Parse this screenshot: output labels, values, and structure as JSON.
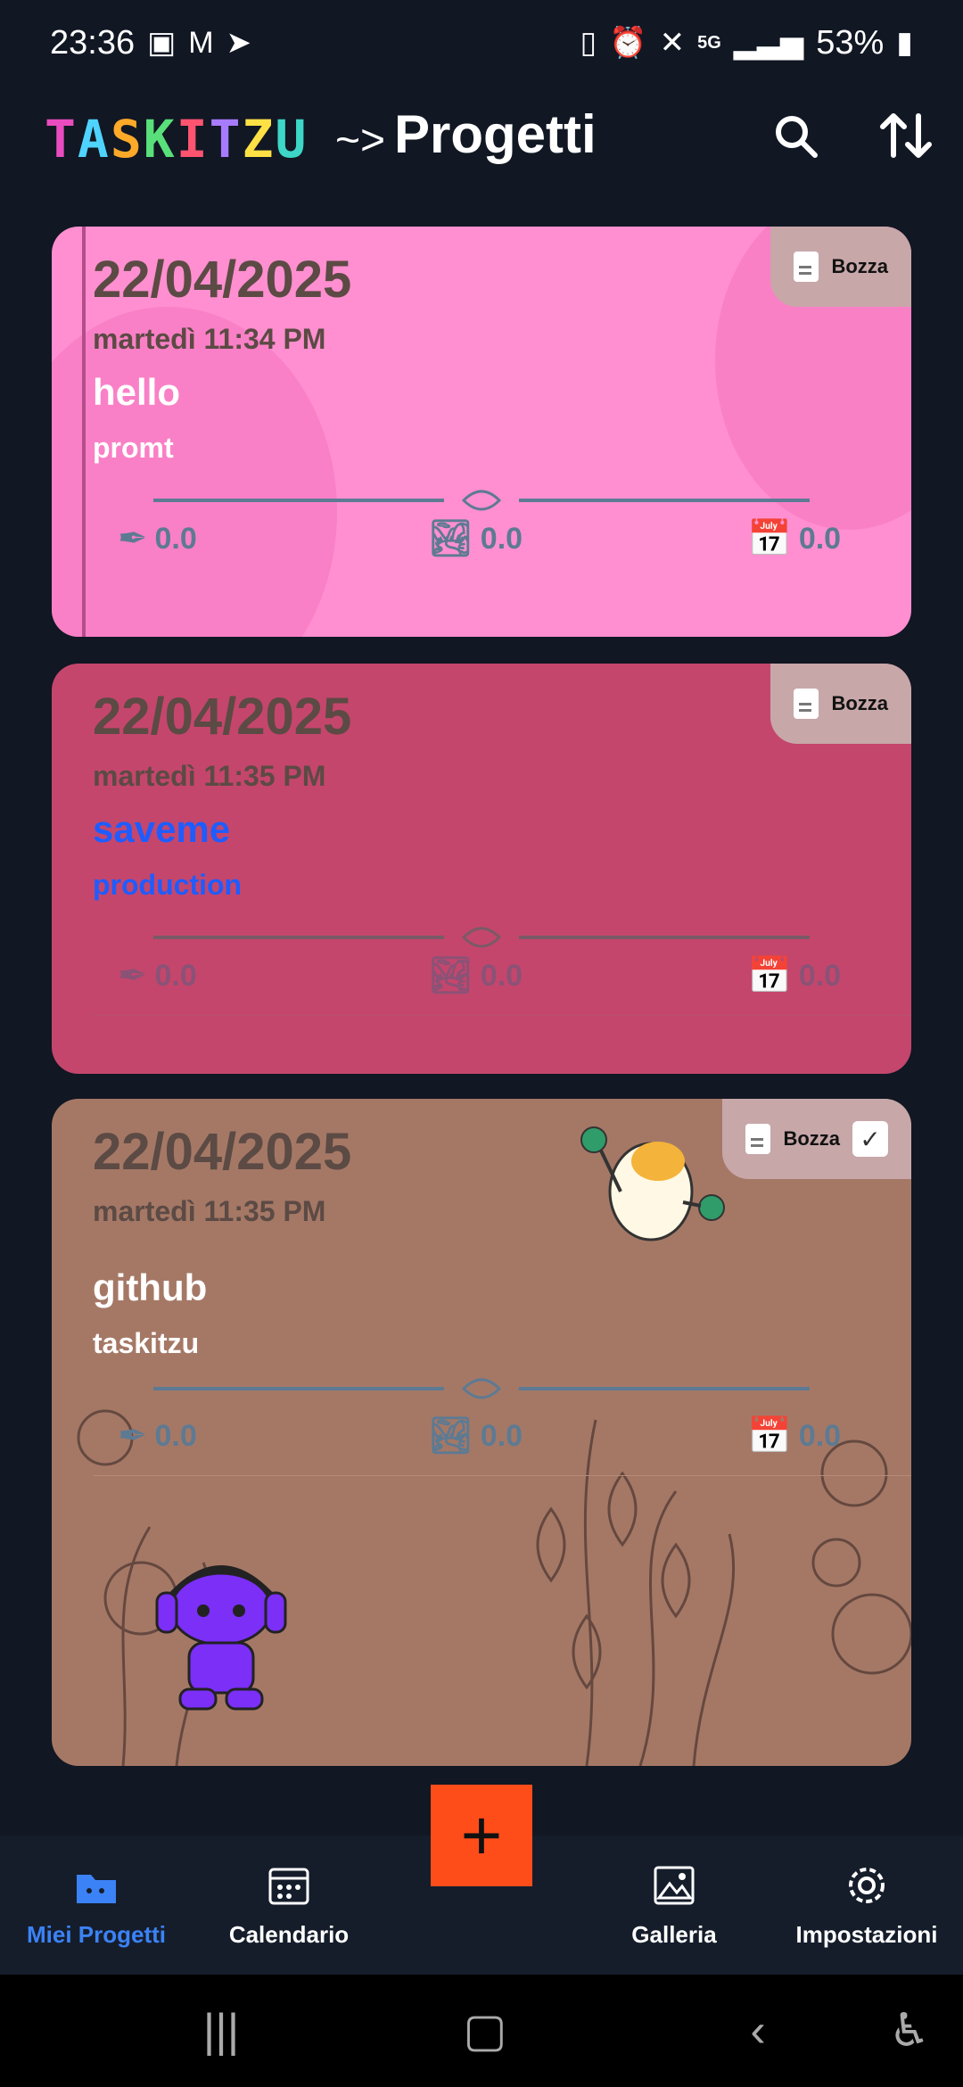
{
  "status_bar": {
    "time": "23:36",
    "battery": "53%",
    "network": "5G"
  },
  "app": {
    "logo": "TASKITZU",
    "arrow": "~>",
    "title": "Progetti"
  },
  "header_icons": {
    "search": "search-icon",
    "sort": "sort-icon"
  },
  "cards": [
    {
      "date": "22/04/2025",
      "weekday_time": "martedì 11:34 PM",
      "name": "hello",
      "description": "promt",
      "badge": "Bozza",
      "stats": {
        "writing": "0.0",
        "images": "0.0",
        "calendar": "0.0"
      },
      "colors": {
        "bg": "#ff8fd0",
        "name": "#ffffff"
      }
    },
    {
      "date": "22/04/2025",
      "weekday_time": "martedì 11:35 PM",
      "name": "saveme",
      "description": "production",
      "badge": "Bozza",
      "stats": {
        "writing": "0.0",
        "images": "0.0",
        "calendar": "0.0"
      },
      "colors": {
        "bg": "#c4466c",
        "name": "#1f5cff"
      }
    },
    {
      "date": "22/04/2025",
      "weekday_time": "martedì 11:35 PM",
      "name": "github",
      "description": "taskitzu",
      "badge": "Bozza",
      "stats": {
        "writing": "0.0",
        "images": "0.0",
        "calendar": "0.0"
      },
      "colors": {
        "bg": "#a57866",
        "name": "#ffffff"
      }
    }
  ],
  "fab": {
    "label": "+"
  },
  "bottom_nav": [
    {
      "label": "Miei Progetti",
      "icon": "folder-icon",
      "active": true
    },
    {
      "label": "Calendario",
      "icon": "calendar-icon",
      "active": false
    },
    {
      "label": "Galleria",
      "icon": "gallery-icon",
      "active": false
    },
    {
      "label": "Impostazioni",
      "icon": "settings-icon",
      "active": false
    }
  ],
  "colors": {
    "background": "#111723",
    "nav": "#151d2b",
    "fab": "#ff4d1a",
    "active": "#3b82f6"
  }
}
